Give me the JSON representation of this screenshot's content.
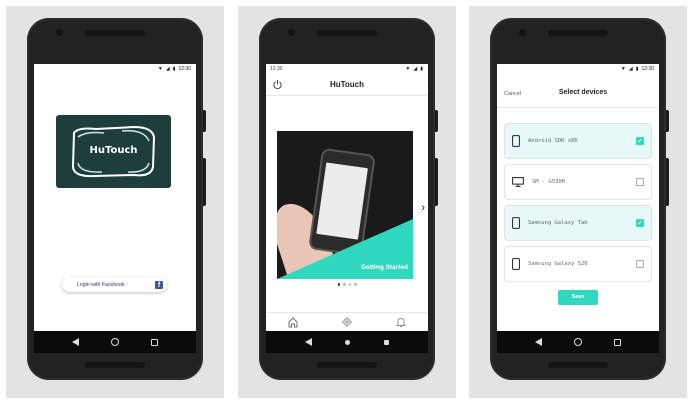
{
  "screen1": {
    "status_time": "12:30",
    "logo_text": "HuTouch",
    "facebook_label": "Login with Facebook",
    "facebook_icon": "f"
  },
  "screen2": {
    "status_time": "12:30",
    "title": "HuTouch",
    "hero_caption": "Getting Started",
    "next_chevron": "›",
    "pager_dots": 4,
    "tabs": [
      {
        "icon": "home-icon"
      },
      {
        "icon": "gear-icon"
      },
      {
        "icon": "bell-icon"
      }
    ]
  },
  "screen3": {
    "status_time": "12:30",
    "cancel_label": "Cancel",
    "title": "Select devices",
    "devices": [
      {
        "name": "Android SDK x86",
        "icon": "phone-icon",
        "checked": true
      },
      {
        "name": "SM - G530H",
        "icon": "monitor-icon",
        "checked": false
      },
      {
        "name": "Samsung Galaxy Tab",
        "icon": "phone-icon",
        "checked": true
      },
      {
        "name": "Samsung Galaxy S20",
        "icon": "phone-icon",
        "checked": false
      }
    ],
    "save_label": "Save"
  },
  "colors": {
    "accent": "#2fd8bf",
    "logo_bg": "#1d3e3b",
    "facebook": "#3b5998",
    "panel_bg": "#e3e3e3"
  }
}
